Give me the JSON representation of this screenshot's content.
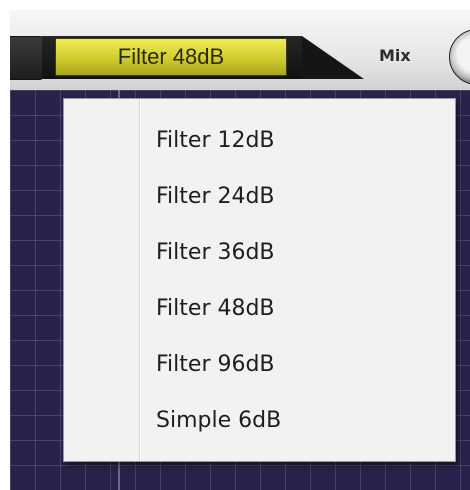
{
  "filter_selector": {
    "current": "Filter 48dB",
    "options": [
      "Filter 12dB",
      "Filter 24dB",
      "Filter 36dB",
      "Filter 48dB",
      "Filter 96dB",
      "Simple 6dB"
    ]
  },
  "mix": {
    "label": "Mix"
  },
  "colors": {
    "button_yellow": "#cfcc2f",
    "graph_background": "#27234b",
    "menu_background": "#f2f2f2"
  }
}
